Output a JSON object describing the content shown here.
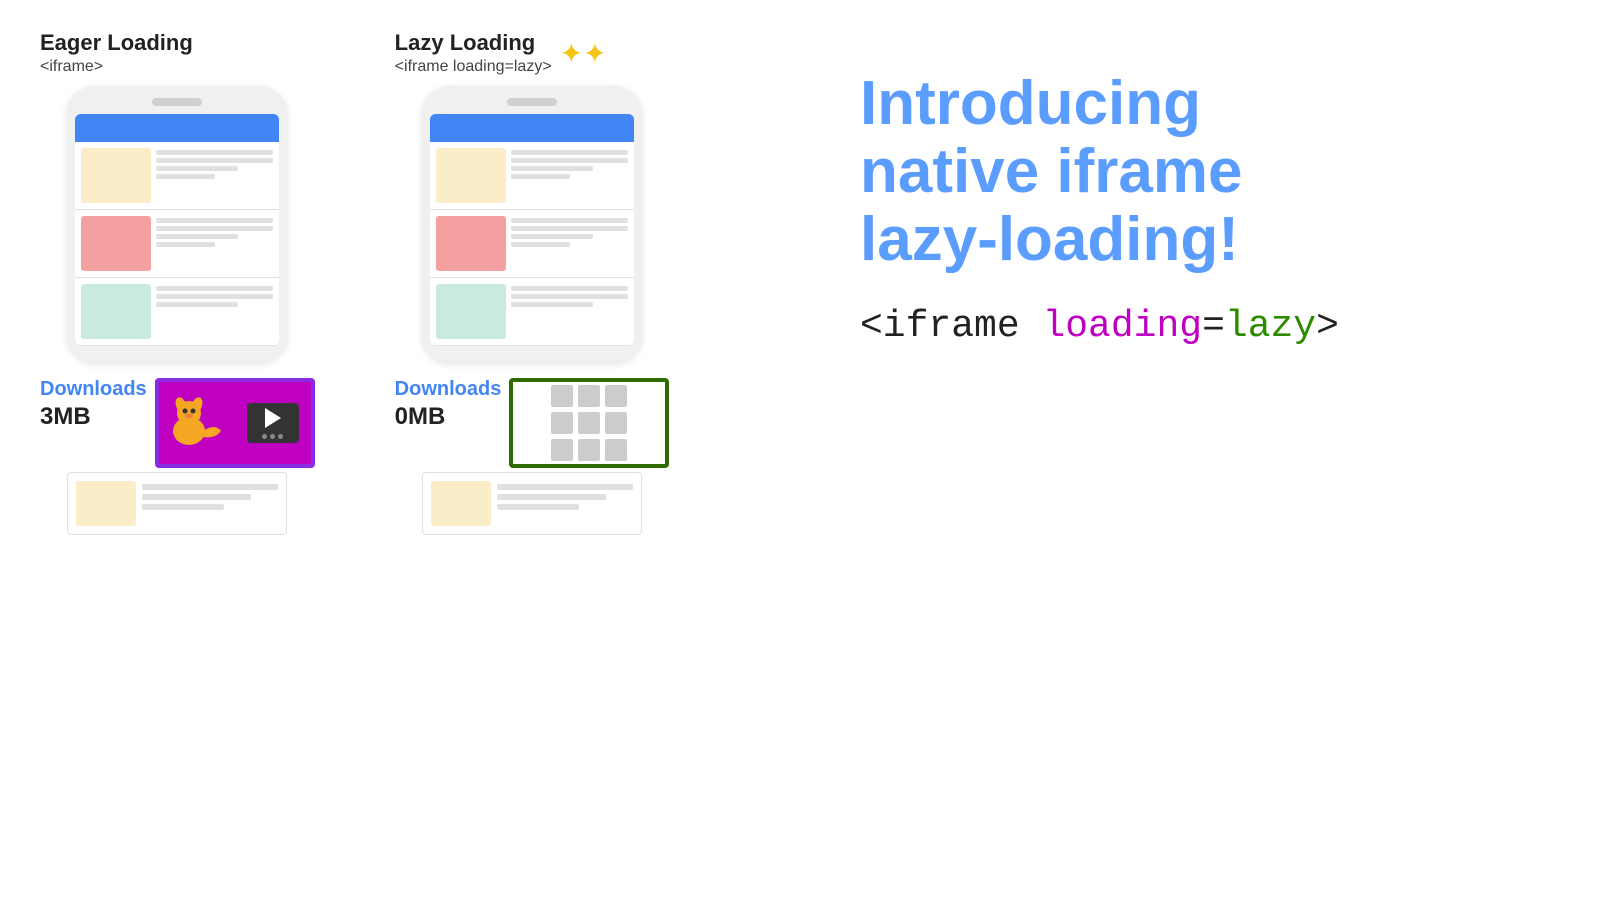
{
  "eager": {
    "title": "Eager Loading",
    "subtitle": "<iframe>",
    "downloads_label": "Downloads",
    "downloads_size": "3MB"
  },
  "lazy": {
    "title": "Lazy Loading",
    "subtitle": "<iframe loading=lazy>",
    "sparkle": "✦",
    "downloads_label": "Downloads",
    "downloads_size": "0MB"
  },
  "intro": {
    "line1": "Introducing",
    "line2": "native iframe",
    "line3": "lazy-loading!"
  },
  "code": {
    "prefix": "<iframe ",
    "loading_word": "loading",
    "equals": "=",
    "lazy_word": "lazy",
    "suffix": ">"
  }
}
